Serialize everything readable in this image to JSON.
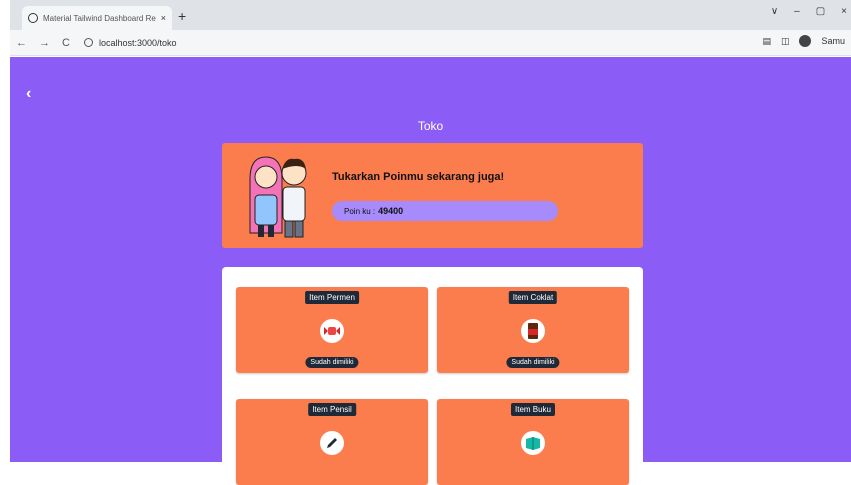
{
  "browser": {
    "tab_title": "Material Tailwind Dashboard Re",
    "tab_close": "×",
    "new_tab": "+",
    "back": "←",
    "forward": "→",
    "reload": "C",
    "url": "localhost:3000/toko",
    "window_controls": [
      "∨",
      "–",
      "▢",
      "×"
    ],
    "profile_label": "Samu"
  },
  "page": {
    "back_glyph": "‹",
    "title": "Toko",
    "hero": {
      "headline": "Tukarkan Poinmu sekarang juga!",
      "points_label": "Poin ku :",
      "points_value": "49400"
    },
    "items": [
      {
        "name": "Item Permen",
        "status": "Sudah dimiliki",
        "icon": "candy-icon"
      },
      {
        "name": "Item Coklat",
        "status": "Sudah dimiliki",
        "icon": "chocolate-icon"
      },
      {
        "name": "Item Pensil",
        "status": "",
        "icon": "pencil-icon"
      },
      {
        "name": "Item Buku",
        "status": "",
        "icon": "book-icon"
      }
    ]
  },
  "colors": {
    "background": "#8b5cf6",
    "accent": "#fb7c4d",
    "points_pill": "#a78bfa",
    "badge": "#1f2937"
  }
}
